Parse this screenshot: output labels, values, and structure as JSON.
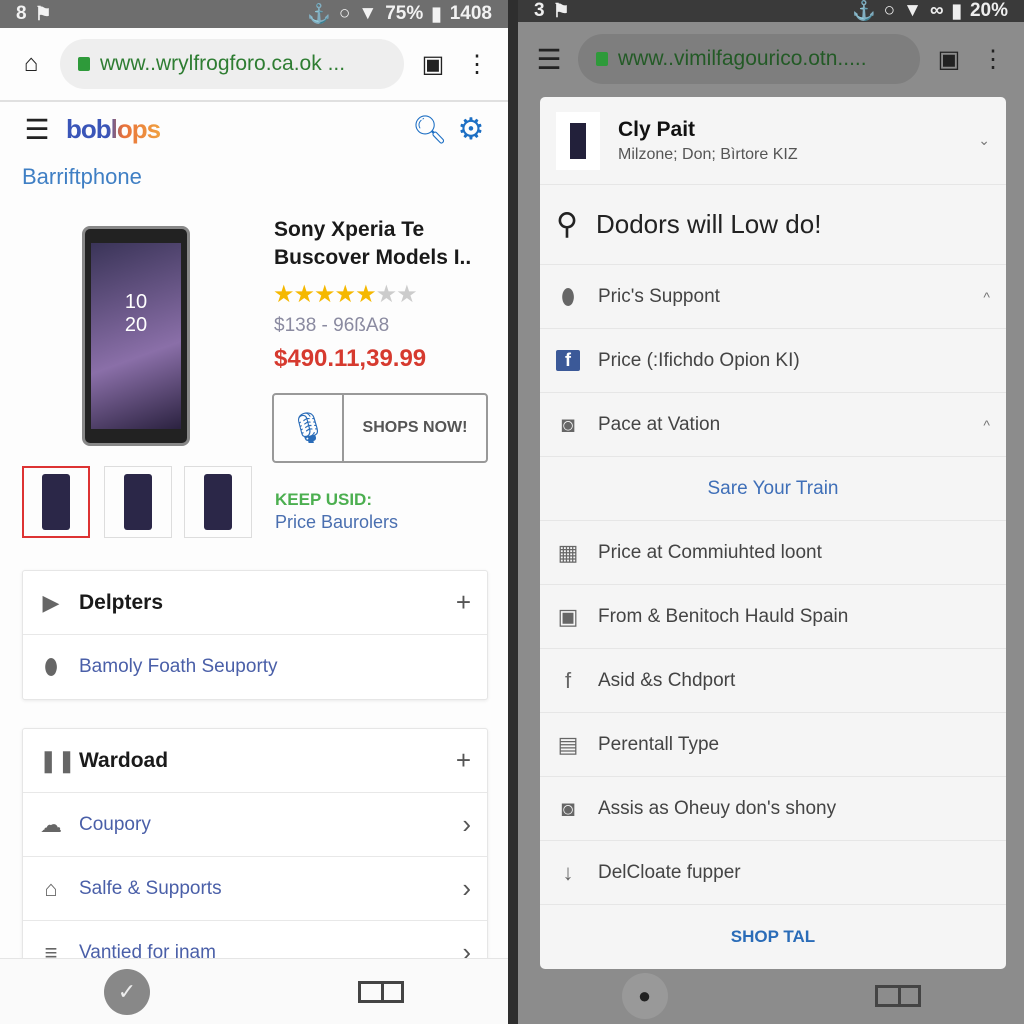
{
  "left": {
    "status": {
      "left": "8",
      "flag": "flag-icon",
      "right": "75%",
      "time": "1408"
    },
    "url": "www..wrylfrogforo.ca.ok ...",
    "logo": "boblops",
    "category": "Barriftphone",
    "product": {
      "title_line1": "Sony Xperia Te",
      "title_line2": "Buscover Models I..",
      "rating": 4,
      "rating_max": 6,
      "price_range": "$138 - 96ßA8",
      "price": "$490.11,39.99",
      "screen_time": "10\n20",
      "shop_button": "SHOPS NOW!",
      "keep_label": "KEEP USID:",
      "price_link": "Price Baurolers"
    },
    "card1": {
      "title": "Delpters",
      "items": [
        {
          "label": "Bamoly Foath Seuporty",
          "icon": "pin-icon"
        }
      ]
    },
    "card2": {
      "title": "Wardoad",
      "items": [
        {
          "label": "Coupory",
          "icon": "cloud-icon"
        },
        {
          "label": "Salfe & Supports",
          "icon": "home-icon"
        },
        {
          "label": "Vantied for inam",
          "icon": "menu-icon"
        }
      ]
    }
  },
  "right": {
    "status": {
      "left": "3",
      "right": "20%"
    },
    "url": "www..vimilfagourico.otn.....",
    "header": {
      "title": "Cly Pait",
      "subtitle": "Milzone; Don; Bìrtore KIZ"
    },
    "greeting": "Dodors will Low do!",
    "items": [
      {
        "label": "Pric's Suppont",
        "icon": "pin-icon",
        "chevron": "up"
      },
      {
        "label": "Price (:Ifichdo Opion KI)",
        "icon": "facebook-icon"
      },
      {
        "label": "Pace at Vation",
        "icon": "instagram-icon",
        "chevron": "up"
      }
    ],
    "link": "Sare Your Train",
    "items2": [
      {
        "label": "Price at Commiuhted loont",
        "icon": "grid-icon"
      },
      {
        "label": "From & Benitoch Hauld Spain",
        "icon": "square-icon"
      },
      {
        "label": "Asid &s Chdport",
        "icon": "facebook-icon"
      },
      {
        "label": "Perentall Type",
        "icon": "layout-icon"
      },
      {
        "label": "Assis as Oheuy don's shony",
        "icon": "instagram-icon"
      },
      {
        "label": "DelCloate fupper",
        "icon": "arrow-down-icon"
      }
    ],
    "shop": "SHOP TAL"
  },
  "colors": {
    "accent": "#2a6cb8",
    "price": "#d63a2f",
    "keep": "#4caf50",
    "star": "#f5b800"
  }
}
